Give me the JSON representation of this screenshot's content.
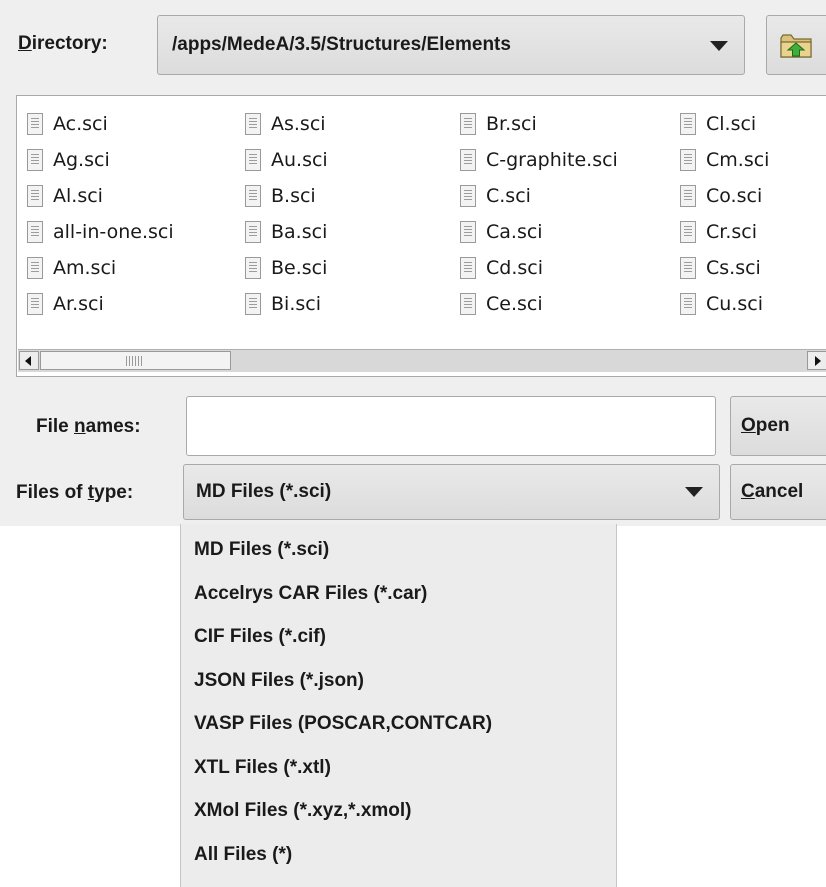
{
  "directory": {
    "label_mnemonic": "D",
    "label_rest": "irectory:",
    "path": "/apps/MedeA/3.5/Structures/Elements"
  },
  "icons": {
    "dropdown": "chevron-down-icon",
    "up_folder": "folder-up-icon",
    "file": "file-icon"
  },
  "files": {
    "columns": [
      [
        "Ac.sci",
        "Ag.sci",
        "Al.sci",
        "all-in-one.sci",
        "Am.sci",
        "Ar.sci"
      ],
      [
        "As.sci",
        "Au.sci",
        "B.sci",
        "Ba.sci",
        "Be.sci",
        "Bi.sci"
      ],
      [
        "Br.sci",
        "C-graphite.sci",
        "C.sci",
        "Ca.sci",
        "Cd.sci",
        "Ce.sci"
      ],
      [
        "Cl.sci",
        "Cm.sci",
        "Co.sci",
        "Cr.sci",
        "Cs.sci",
        "Cu.sci"
      ]
    ]
  },
  "file_names": {
    "label_pre": "File ",
    "label_mnemonic": "n",
    "label_rest": "ames:",
    "value": ""
  },
  "files_of_type": {
    "label_pre": "Files of ",
    "label_mnemonic": "t",
    "label_rest": "ype:",
    "selected": "MD Files (*.sci)",
    "options": [
      "MD Files (*.sci)",
      "Accelrys CAR Files (*.car)",
      "CIF Files (*.cif)",
      "JSON Files (*.json)",
      "VASP Files (POSCAR,CONTCAR)",
      "XTL Files (*.xtl)",
      "XMol Files (*.xyz,*.xmol)",
      "All Files (*)"
    ]
  },
  "buttons": {
    "open_mnemonic": "O",
    "open_rest": "pen",
    "cancel_mnemonic": "C",
    "cancel_rest": "ancel"
  }
}
